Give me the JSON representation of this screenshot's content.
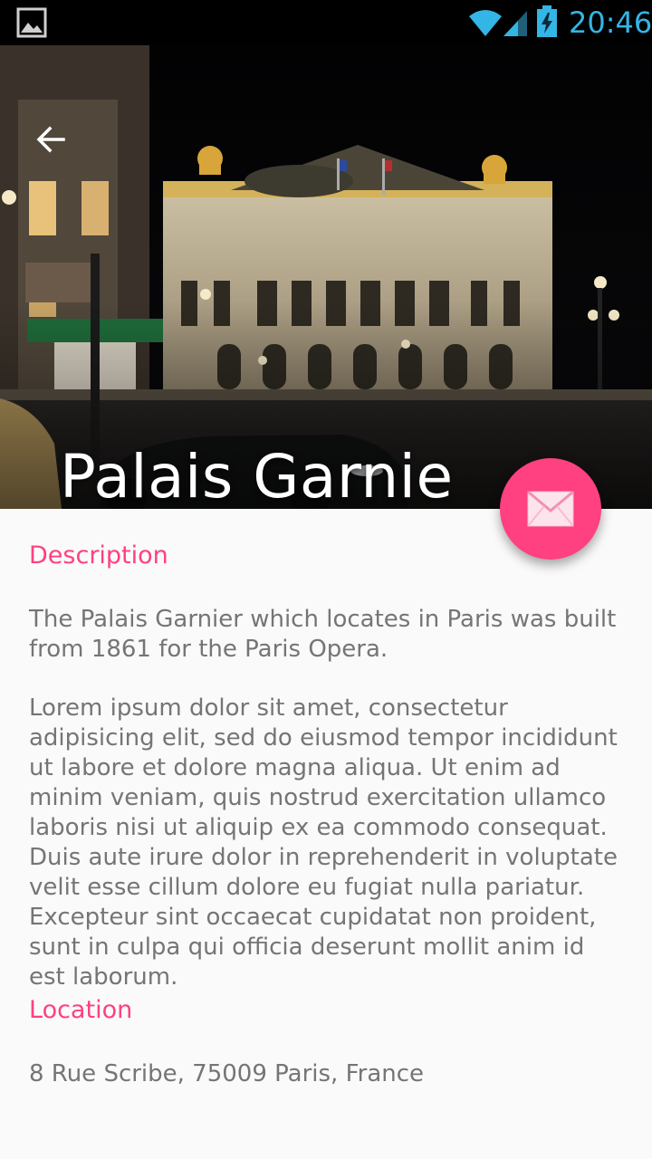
{
  "status_bar": {
    "time": "20:46",
    "icons": [
      "gallery-icon",
      "wifi-icon",
      "signal-icon",
      "battery-charging-icon"
    ],
    "time_color": "#33b5e5"
  },
  "header": {
    "title": "Palais Garnie",
    "back_icon": "arrow-back-icon",
    "image": "opera-house-night-photo"
  },
  "fab": {
    "icon": "mail-icon",
    "color": "#ff4081"
  },
  "description": {
    "title": "Description",
    "paragraph_1": "The Palais Garnier which locates in Paris was built from 1861 for the Paris Opera.",
    "paragraph_2": "Lorem ipsum dolor sit amet, consectetur adipisicing elit, sed do eiusmod tempor incididunt ut labore et dolore magna aliqua. Ut enim ad minim veniam, quis nostrud exercitation ullamco laboris nisi ut aliquip ex ea commodo consequat. Duis aute irure dolor in reprehenderit in voluptate velit esse cillum dolore eu fugiat nulla pariatur. Excepteur sint occaecat cupidatat non proident, sunt in culpa qui officia deserunt mollit anim id est laborum."
  },
  "location": {
    "title": "Location",
    "address": "8 Rue Scribe, 75009 Paris, France"
  },
  "colors": {
    "accent": "#ff4081",
    "body_text": "#757575",
    "background": "#fafafa"
  }
}
